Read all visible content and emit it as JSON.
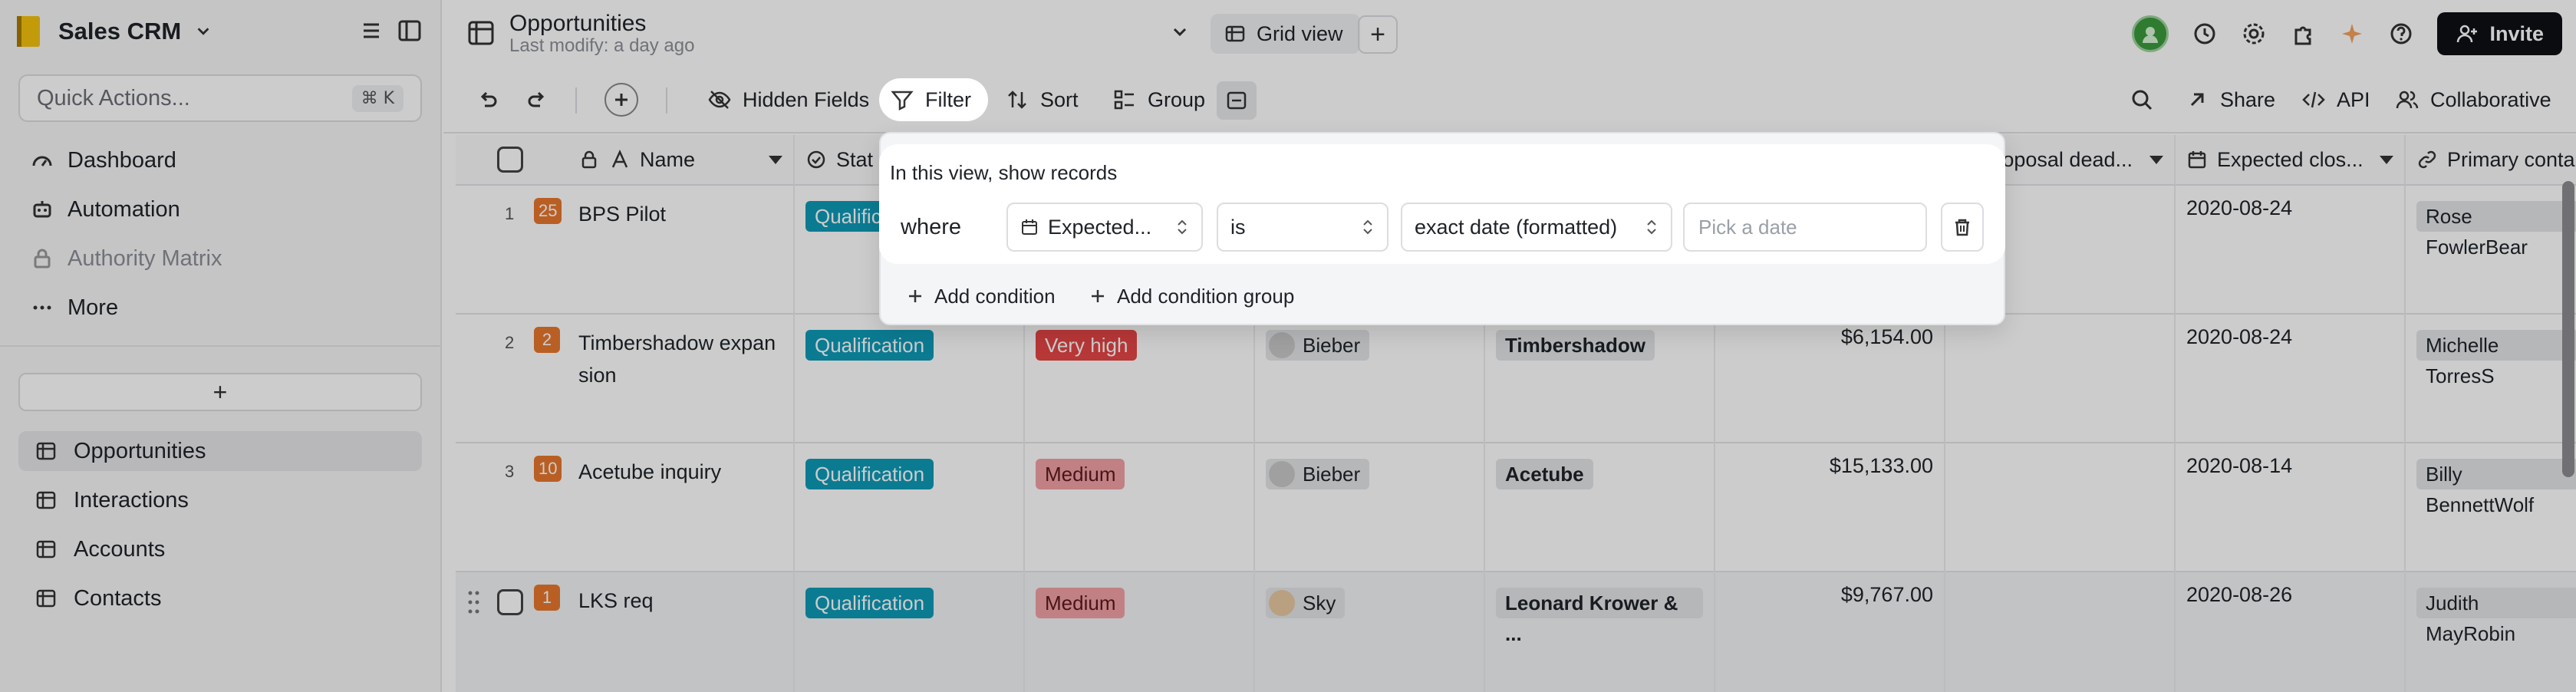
{
  "sidebar": {
    "space_name": "Sales CRM",
    "quick_actions": {
      "label": "Quick Actions...",
      "shortcut": "⌘ K"
    },
    "nav": [
      {
        "label": "Dashboard",
        "icon": "dashboard-icon"
      },
      {
        "label": "Automation",
        "icon": "robot-icon"
      },
      {
        "label": "Authority Matrix",
        "icon": "lock-icon"
      },
      {
        "label": "More",
        "icon": "ellipsis-icon"
      }
    ],
    "add_label": "+",
    "tables": [
      {
        "label": "Opportunities",
        "active": true
      },
      {
        "label": "Interactions",
        "active": false
      },
      {
        "label": "Accounts",
        "active": false
      },
      {
        "label": "Contacts",
        "active": false
      }
    ]
  },
  "header": {
    "title": "Opportunities",
    "subtitle": "Last modify: a day ago",
    "view_tab": "Grid view",
    "add_view": "+",
    "invite": "Invite"
  },
  "toolbar": {
    "hidden_fields": "Hidden Fields",
    "filter": "Filter",
    "sort": "Sort",
    "group": "Group",
    "share": "Share",
    "api": "API",
    "collaborative": "Collaborative"
  },
  "grid": {
    "columns": {
      "name": "Name",
      "status": "Stat",
      "proposal": "oposal dead...",
      "expected": "Expected clos...",
      "primary": "Primary conta"
    },
    "rows": [
      {
        "num": "1",
        "prio": "25",
        "name": "BPS Pilot",
        "status": "Qualification",
        "priority": "",
        "owner": "",
        "account": "",
        "amount": "",
        "expected": "2020-08-24",
        "contact": "Rose FowlerBear"
      },
      {
        "num": "2",
        "prio": "2",
        "name": "Timbershadow expan sion",
        "status": "Qualification",
        "priority": "Very high",
        "owner": "Bieber",
        "account": "Timbershadow",
        "amount": "$6,154.00",
        "expected": "2020-08-24",
        "contact": "Michelle TorresS"
      },
      {
        "num": "3",
        "prio": "10",
        "name": "Acetube inquiry",
        "status": "Qualification",
        "priority": "Medium",
        "owner": "Bieber",
        "account": "Acetube",
        "amount": "$15,133.00",
        "expected": "2020-08-14",
        "contact": "Billy BennettWolf"
      },
      {
        "num": "",
        "prio": "1",
        "name": "LKS req",
        "status": "Qualification",
        "priority": "Medium",
        "owner": "Sky",
        "account": "Leonard Krower & ...",
        "amount": "$9,767.00",
        "expected": "2020-08-26",
        "contact": "Judith MayRobin"
      }
    ]
  },
  "filter": {
    "heading": "In this view, show records",
    "where": "where",
    "field": "Expected...",
    "operator": "is",
    "mode": "exact date (formatted)",
    "date_placeholder": "Pick a date",
    "add_condition": "Add condition",
    "add_group": "Add condition group"
  },
  "colors": {
    "qualification": "#0e9ab7",
    "very_high": "#e64545",
    "medium": "#f2a2a6",
    "priority_badge": "#e8772e"
  }
}
